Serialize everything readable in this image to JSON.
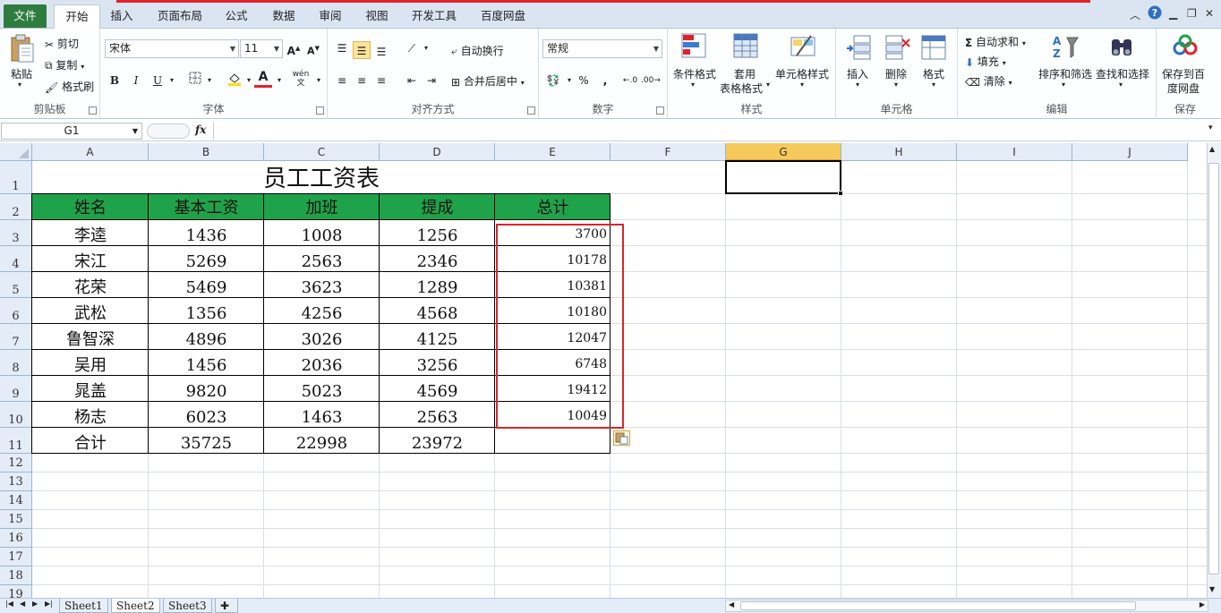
{
  "ribbon_tabs": [
    "文件",
    "开始",
    "插入",
    "页面布局",
    "公式",
    "数据",
    "审阅",
    "视图",
    "开发工具",
    "百度网盘"
  ],
  "clipboard": {
    "paste": "粘贴",
    "cut": "剪切",
    "copy": "复制",
    "format_painter": "格式刷",
    "label": "剪贴板"
  },
  "font": {
    "name": "宋体",
    "size": "11",
    "label": "字体"
  },
  "alignment": {
    "wrap": "自动换行",
    "merge": "合并后居中",
    "label": "对齐方式"
  },
  "number": {
    "format": "常规",
    "percent": "%",
    "comma": ",",
    "label": "数字"
  },
  "styles": {
    "conditional": "条件格式",
    "table_format_1": "套用",
    "table_format_2": "表格格式",
    "cell_styles": "单元格样式",
    "label": "样式"
  },
  "cells": {
    "insert": "插入",
    "delete": "删除",
    "format": "格式",
    "label": "单元格"
  },
  "editing": {
    "autosum": "自动求和",
    "fill": "填充",
    "clear": "清除",
    "sort": "排序和筛选",
    "find": "查找和选择",
    "label": "编辑"
  },
  "save": {
    "btn_1": "保存到百",
    "btn_2": "度网盘",
    "label": "保存"
  },
  "formula_bar": {
    "name_box": "G1",
    "fx": "fx",
    "formula": ""
  },
  "columns": [
    "A",
    "B",
    "C",
    "D",
    "E",
    "F",
    "G",
    "H",
    "I",
    "J"
  ],
  "rows": [
    "1",
    "2",
    "3",
    "4",
    "5",
    "6",
    "7",
    "8",
    "9",
    "10",
    "11",
    "12",
    "13",
    "14",
    "15",
    "16",
    "17",
    "18",
    "19"
  ],
  "sheet": {
    "title": "员工工资表",
    "headers": [
      "姓名",
      "基本工资",
      "加班",
      "提成",
      "总计"
    ],
    "data": [
      [
        "李逵",
        "1436",
        "1008",
        "1256",
        "3700"
      ],
      [
        "宋江",
        "5269",
        "2563",
        "2346",
        "10178"
      ],
      [
        "花荣",
        "5469",
        "3623",
        "1289",
        "10381"
      ],
      [
        "武松",
        "1356",
        "4256",
        "4568",
        "10180"
      ],
      [
        "鲁智深",
        "4896",
        "3026",
        "4125",
        "12047"
      ],
      [
        "吴用",
        "1456",
        "2036",
        "3256",
        "6748"
      ],
      [
        "晁盖",
        "9820",
        "5023",
        "4569",
        "19412"
      ],
      [
        "杨志",
        "6023",
        "1463",
        "2563",
        "10049"
      ]
    ],
    "totals": [
      "合计",
      "35725",
      "22998",
      "23972",
      ""
    ]
  },
  "sheet_tabs": [
    "Sheet1",
    "Sheet2",
    "Sheet3"
  ],
  "active_sheet": "Sheet2",
  "colors": {
    "header_green": "#1fa34a",
    "file_tab": "#2f7c3f",
    "highlight_red": "#d9262e",
    "selected_col": "#f5c95b"
  }
}
